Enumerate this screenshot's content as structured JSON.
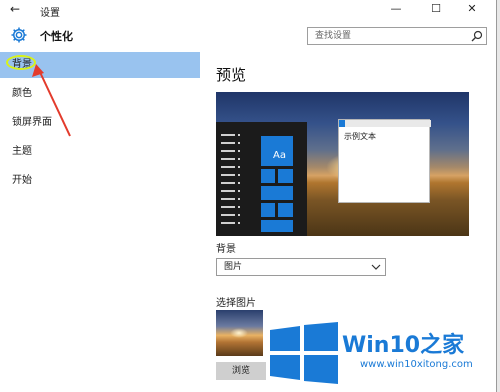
{
  "window": {
    "title": "设置",
    "back_glyph": "←",
    "minimize_glyph": "—",
    "maximize_glyph": "☐",
    "close_glyph": "✕"
  },
  "sidebar": {
    "header": "个性化",
    "items": [
      {
        "label": "背景",
        "selected": true
      },
      {
        "label": "颜色",
        "selected": false
      },
      {
        "label": "锁屏界面",
        "selected": false
      },
      {
        "label": "主题",
        "selected": false
      },
      {
        "label": "开始",
        "selected": false
      }
    ]
  },
  "search": {
    "placeholder": "查找设置",
    "icon": "search-icon"
  },
  "main": {
    "heading": "预览",
    "preview": {
      "tile_text": "Aa",
      "sample_window_text": "示例文本"
    },
    "background_label": "背景",
    "background_value": "图片",
    "choose_picture_label": "选择图片",
    "browse_label": "浏览"
  },
  "watermark": {
    "brand": "Win10",
    "brand_suffix": "之家",
    "url": "www.win10xitong.com"
  },
  "colors": {
    "accent": "#1a7ad6",
    "selected_nav": "#99c3ef",
    "highlight_circle": "#d8f21a",
    "annotation_arrow": "#e33b2c"
  }
}
